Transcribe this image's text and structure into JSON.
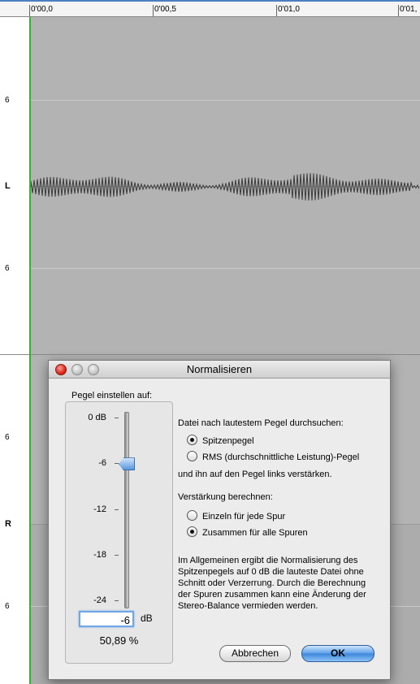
{
  "ruler": {
    "labels": [
      "0'00,0",
      "0'00,5",
      "0'01,0",
      "0'01,"
    ]
  },
  "tracks": {
    "left": {
      "channel": "L",
      "scale_top": "6",
      "scale_bottom": "6"
    },
    "right": {
      "channel": "R",
      "scale_top": "6",
      "scale_bottom": "6"
    }
  },
  "dialog": {
    "title": "Normalisieren",
    "level_caption": "Pegel einstellen auf:",
    "scale": [
      "0 dB",
      "-6",
      "-12",
      "-18",
      "-24"
    ],
    "slider_value_db": -6,
    "db_value": "-6",
    "db_unit": "dB",
    "percent": "50,89 %",
    "scan_heading": "Datei nach lautestem Pegel durchsuchen:",
    "scan_options": [
      {
        "label": "Spitzenpegel",
        "selected": true
      },
      {
        "label": "RMS (durchschnittliche Leistung)-Pegel",
        "selected": false
      }
    ],
    "amplify_note": "und ihn auf den Pegel links verstärken.",
    "gain_heading": "Verstärkung berechnen:",
    "gain_options": [
      {
        "label": "Einzeln für jede Spur",
        "selected": false
      },
      {
        "label": "Zusammen für alle Spuren",
        "selected": true
      }
    ],
    "info_text": "Im Allgemeinen ergibt die Normalisierung des Spitzenpegels auf 0 dB die lauteste Datei ohne Schnitt oder Verzerrung. Durch die Berechnung der Spuren zusammen kann eine Änderung der Stereo-Balance vermieden werden.",
    "cancel_label": "Abbrechen",
    "ok_label": "OK"
  }
}
